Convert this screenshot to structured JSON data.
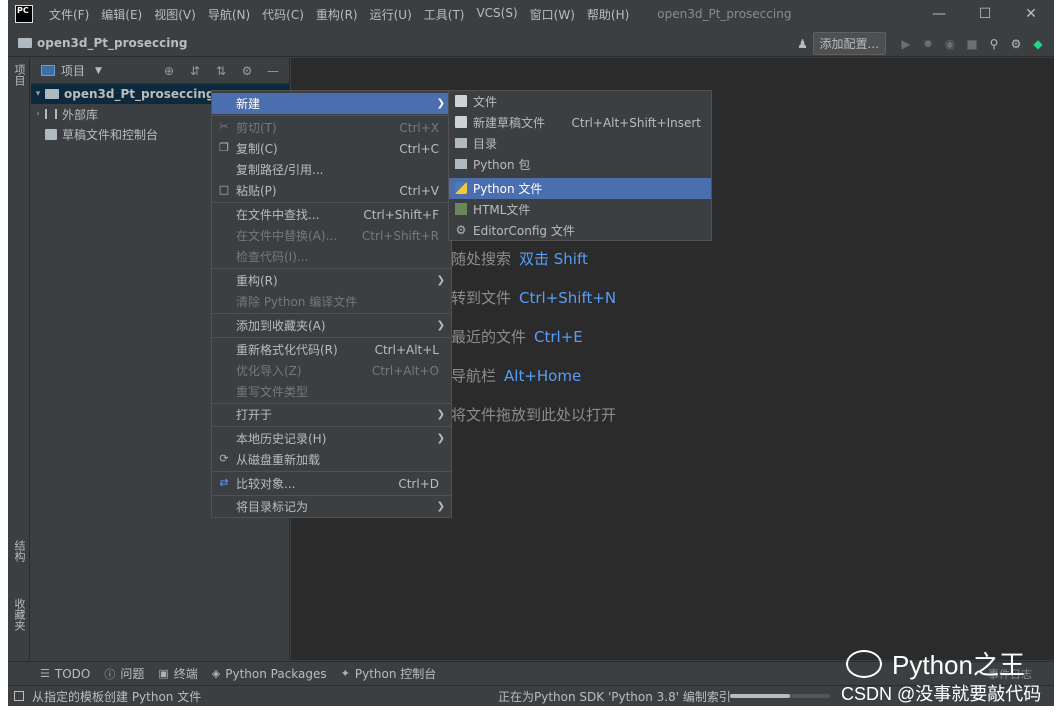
{
  "menubar": {
    "logo": "PC",
    "items": [
      "文件(F)",
      "编辑(E)",
      "视图(V)",
      "导航(N)",
      "代码(C)",
      "重构(R)",
      "运行(U)",
      "工具(T)",
      "VCS(S)",
      "窗口(W)",
      "帮助(H)"
    ],
    "window_title": "open3d_Pt_proseccing",
    "controls": [
      "—",
      "☐",
      "✕"
    ]
  },
  "navbar": {
    "project": "open3d_Pt_proseccing",
    "add_config": "添加配置..."
  },
  "left_strip": {
    "project_tab": "项目",
    "structure_tab": "结构",
    "favorites_tab": "收藏夹"
  },
  "project_panel": {
    "title": "项目",
    "tree": [
      {
        "label": "open3d_Pt_proseccing",
        "arrow": "▾"
      },
      {
        "label": "外部库",
        "arrow": "›"
      },
      {
        "label": "草稿文件和控制台",
        "arrow": ""
      }
    ]
  },
  "editor_hints": [
    {
      "text": "随处搜索",
      "key": "双击 Shift"
    },
    {
      "text": "转到文件",
      "key": "Ctrl+Shift+N"
    },
    {
      "text": "最近的文件",
      "key": "Ctrl+E"
    },
    {
      "text": "导航栏",
      "key": "Alt+Home"
    },
    {
      "text": "将文件拖放到此处以打开",
      "key": ""
    }
  ],
  "context_menu": [
    {
      "label": "新建",
      "shortcut": "",
      "submenu": true
    },
    {
      "label": "剪切(T)",
      "shortcut": "Ctrl+X"
    },
    {
      "label": "复制(C)",
      "shortcut": "Ctrl+C"
    },
    {
      "label": "复制路径/引用...",
      "shortcut": ""
    },
    {
      "label": "粘贴(P)",
      "shortcut": "Ctrl+V"
    },
    {
      "label": "在文件中查找...",
      "shortcut": "Ctrl+Shift+F"
    },
    {
      "label": "在文件中替换(A)...",
      "shortcut": "Ctrl+Shift+R"
    },
    {
      "label": "检查代码(I)...",
      "shortcut": ""
    },
    {
      "label": "重构(R)",
      "shortcut": "",
      "submenu": true
    },
    {
      "label": "清除 Python 编译文件",
      "shortcut": ""
    },
    {
      "label": "添加到收藏夹(A)",
      "shortcut": "",
      "submenu": true
    },
    {
      "label": "重新格式化代码(R)",
      "shortcut": "Ctrl+Alt+L"
    },
    {
      "label": "优化导入(Z)",
      "shortcut": "Ctrl+Alt+O"
    },
    {
      "label": "重写文件类型",
      "shortcut": ""
    },
    {
      "label": "打开于",
      "shortcut": "",
      "submenu": true
    },
    {
      "label": "本地历史记录(H)",
      "shortcut": "",
      "submenu": true
    },
    {
      "label": "从磁盘重新加载",
      "shortcut": ""
    },
    {
      "label": "比较对象...",
      "shortcut": "Ctrl+D"
    },
    {
      "label": "将目录标记为",
      "shortcut": "",
      "submenu": true
    }
  ],
  "submenu": [
    {
      "label": "文件",
      "shortcut": ""
    },
    {
      "label": "新建草稿文件",
      "shortcut": "Ctrl+Alt+Shift+Insert"
    },
    {
      "label": "目录",
      "shortcut": ""
    },
    {
      "label": "Python 包",
      "shortcut": ""
    },
    {
      "label": "Python 文件",
      "shortcut": ""
    },
    {
      "label": "HTML文件",
      "shortcut": ""
    },
    {
      "label": "EditorConfig 文件",
      "shortcut": ""
    }
  ],
  "tool_tabs": [
    "TODO",
    "问题",
    "终端",
    "Python Packages",
    "Python 控制台"
  ],
  "event_log": "事件日志",
  "status": {
    "left": "从指定的模板创建 Python 文件",
    "right": "正在为Python SDK 'Python 3.8' 编制索引",
    "progress": 0.6
  },
  "watermark": {
    "brand": "Python之王",
    "csdn": "CSDN @没事就要敲代码"
  }
}
